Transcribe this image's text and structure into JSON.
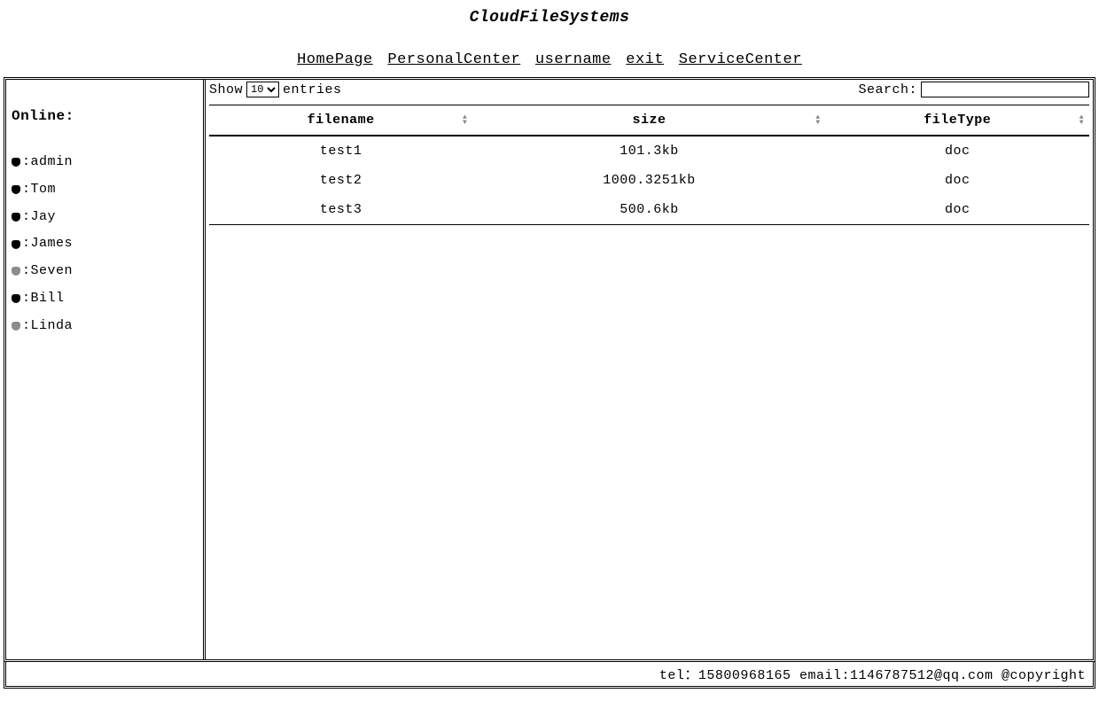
{
  "app": {
    "title": "CloudFileSystems"
  },
  "nav": {
    "items": [
      "HomePage",
      "PersonalCenter",
      "username",
      "exit",
      "ServiceCenter"
    ]
  },
  "sidebar": {
    "header": "Online:",
    "users": [
      {
        "name": "admin",
        "online": true
      },
      {
        "name": "Tom",
        "online": true
      },
      {
        "name": "Jay",
        "online": true
      },
      {
        "name": "James",
        "online": true
      },
      {
        "name": "Seven",
        "online": false
      },
      {
        "name": "Bill",
        "online": true
      },
      {
        "name": "Linda",
        "online": false
      }
    ]
  },
  "toolbar": {
    "show_label": "Show",
    "entries_label": "entries",
    "entries_value": "10",
    "entries_options": [
      "10"
    ],
    "search_label": "Search:"
  },
  "table": {
    "columns": [
      "filename",
      "size",
      "fileType"
    ],
    "rows": [
      {
        "filename": "test1",
        "size": "101.3kb",
        "fileType": "doc"
      },
      {
        "filename": "test2",
        "size": "1000.3251kb",
        "fileType": "doc"
      },
      {
        "filename": "test3",
        "size": "500.6kb",
        "fileType": "doc"
      }
    ]
  },
  "footer": {
    "text": "tel：15800968165 email:1146787512@qq.com @copyright"
  }
}
